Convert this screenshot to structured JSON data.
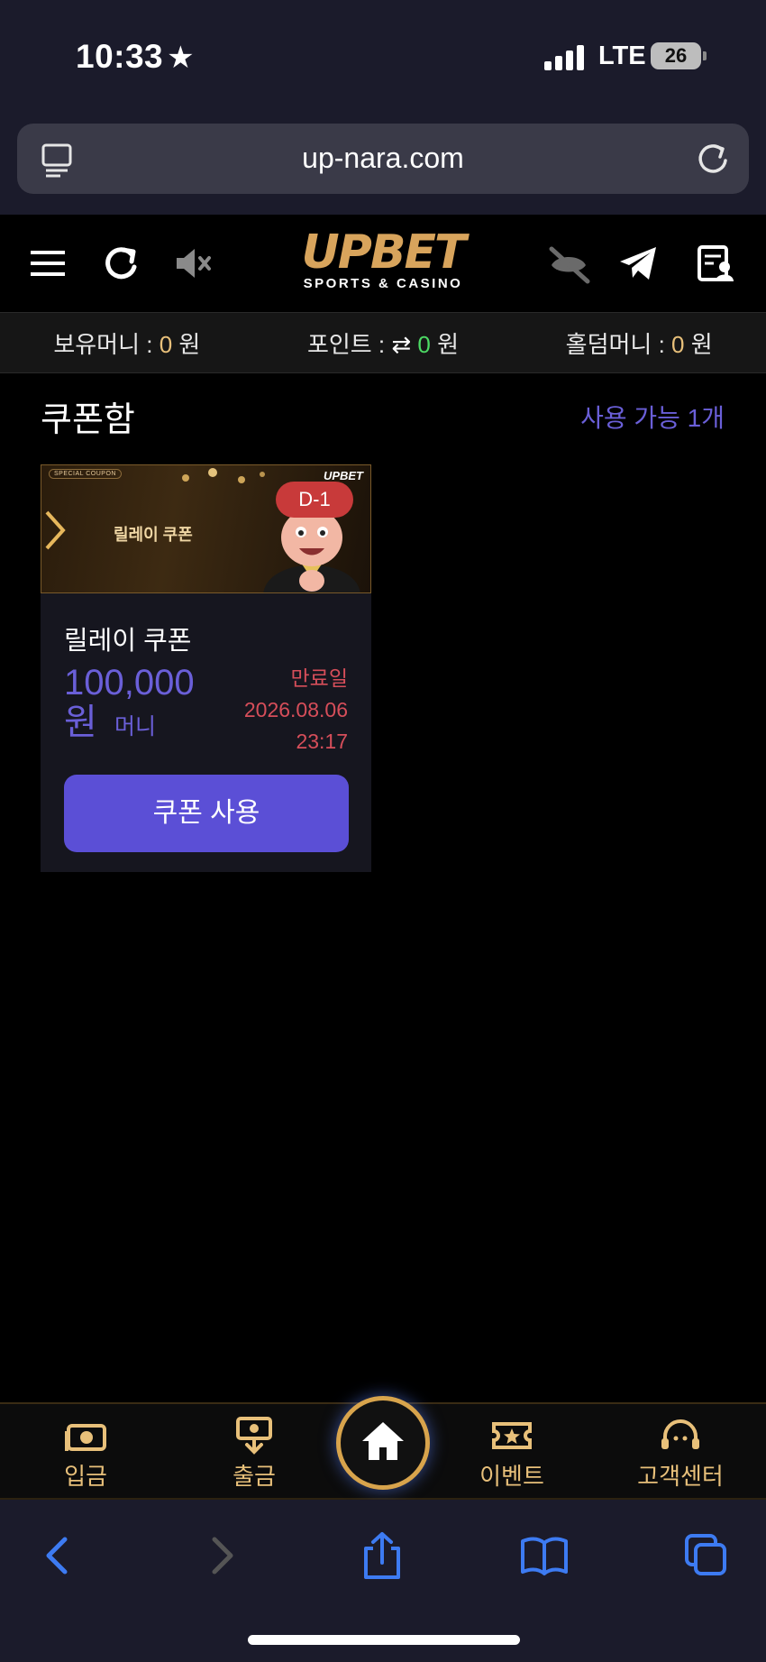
{
  "status_bar": {
    "time": "10:33",
    "network": "LTE",
    "battery": "26"
  },
  "browser": {
    "url": "up-nara.com"
  },
  "header": {
    "logo_main": "UPBET",
    "logo_sub": "SPORTS & CASINO"
  },
  "balances": {
    "money_label": "보유머니 :",
    "money_value": "0",
    "money_unit": "원",
    "point_label": "포인트 :",
    "point_value": "0",
    "point_unit": "원",
    "holdem_label": "홀덤머니 :",
    "holdem_value": "0",
    "holdem_unit": "원"
  },
  "coupon_box": {
    "title": "쿠폰함",
    "available": "사용 가능 1개"
  },
  "coupon": {
    "banner_badge": "SPECIAL COUPON",
    "banner_brand": "UPBET",
    "banner_title": "릴레이 쿠폰",
    "dday": "D-1",
    "name": "릴레이 쿠폰",
    "amount": "100,000",
    "amount_unit": "원",
    "amount_type": "머니",
    "expiry_label": "만료일",
    "expiry_date": "2026.08.06",
    "expiry_time": "23:17",
    "use_button": "쿠폰 사용"
  },
  "bottom_nav": {
    "deposit": "입금",
    "withdraw": "출금",
    "event": "이벤트",
    "support": "고객센터"
  },
  "colors": {
    "accent_purple": "#5b4fd6",
    "gold": "#e8c07a",
    "expiry_red": "#d64e5a",
    "green": "#4cd964"
  }
}
